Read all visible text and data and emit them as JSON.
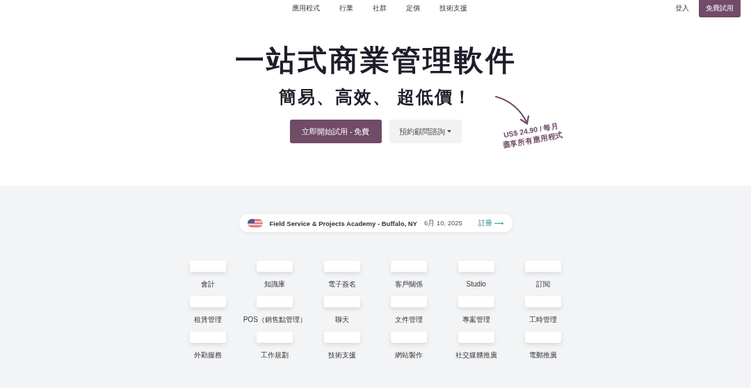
{
  "nav": {
    "links": [
      "應用程式",
      "行業",
      "社群",
      "定價",
      "技術支援"
    ],
    "login": "登入",
    "trial_button": "免費試用"
  },
  "hero": {
    "title": "一站式商業管理軟件",
    "subtitle": "簡易、高效、 超低價！",
    "primary_button": "立即開始試用 - 免費",
    "secondary_button": "預約顧問諮詢",
    "price": "US$ 24.90 / 每月",
    "price_note": "盡享所有應用程式"
  },
  "event": {
    "title": "Field Service & Projects Academy - Buffalo, NY",
    "date": "6月 10, 2025",
    "link": "註冊",
    "link_arrow": "⟶"
  },
  "apps": [
    "會計",
    "知識庫",
    "電子簽名",
    "客戶關係",
    "Studio",
    "訂閱",
    "租賃管理",
    "POS（銷售點管理）",
    "聊天",
    "文件管理",
    "專案管理",
    "工時管理",
    "外勤服務",
    "工作規劃",
    "技術支援",
    "網站製作",
    "社交媒體推廣",
    "電郵推廣"
  ]
}
